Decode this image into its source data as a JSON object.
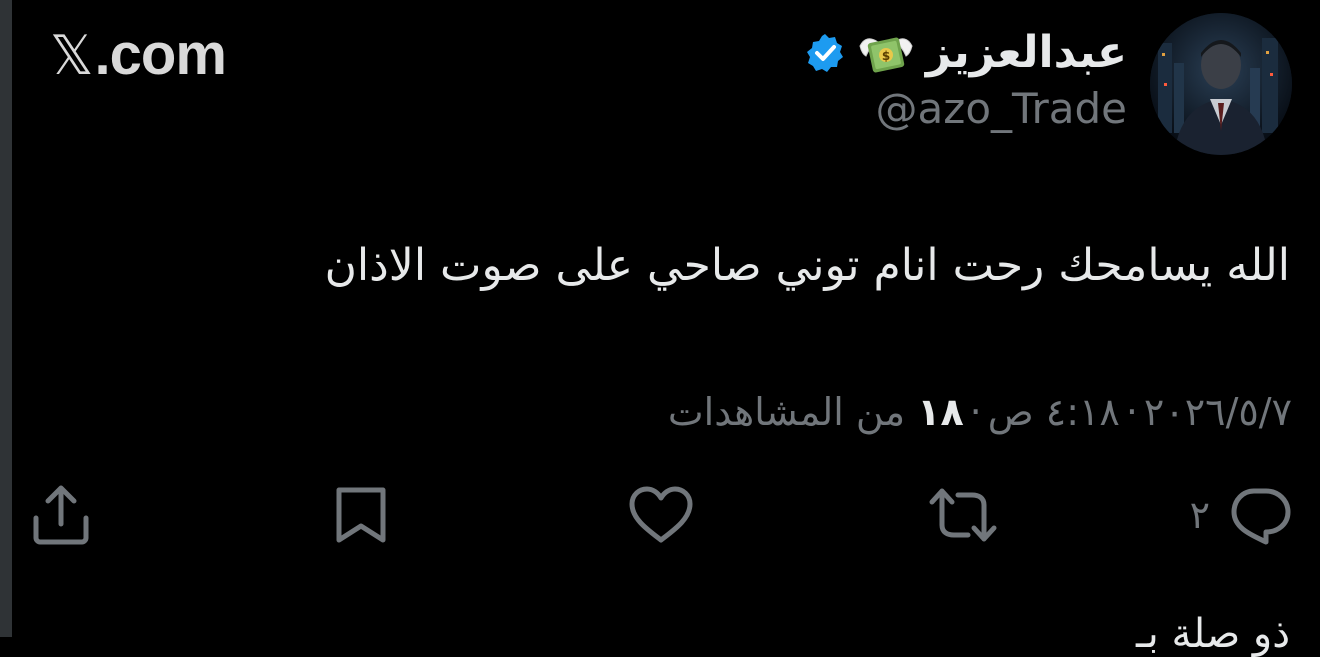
{
  "site": {
    "brand": ".com",
    "brand_glyph": "𝕏"
  },
  "author": {
    "display_name": "عبدالعزيز",
    "handle": "@azo_Trade",
    "name_emoji": "money-with-wings-icon",
    "verified": true,
    "verified_color": "#1d9bf0"
  },
  "tweet": {
    "text": "الله يسامحك رحت انام توني صاحي على صوت الاذان",
    "date": "٢٠٢٦/٥/٧",
    "time": "٤:١٨ ص",
    "views_count": "١٨",
    "views_label": "من المشاهدات",
    "separator": "·"
  },
  "actions": {
    "reply_count": "٢",
    "icons": [
      "reply-icon",
      "retweet-icon",
      "like-icon",
      "bookmark-icon",
      "share-icon"
    ]
  },
  "colors": {
    "background": "#000000",
    "text_primary": "#e7e9ea",
    "text_secondary": "#71767b",
    "accent": "#1d9bf0"
  },
  "below": {
    "partial_text": "ذو صلة بـ"
  }
}
